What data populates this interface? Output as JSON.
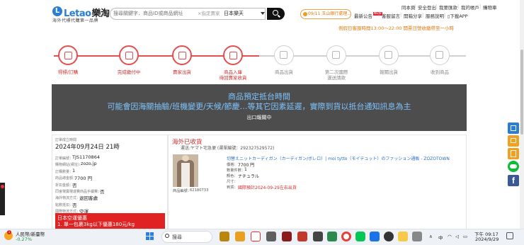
{
  "header": {
    "logo_glyph": "L",
    "logo_text": "Letao",
    "logo_cn": "樂淘",
    "logo_sub": "海外代標代購第一品牌",
    "search_placeholder": "搜尋關鍵字．商品ID或商品網址",
    "search_tag": "×指定賣家",
    "search_select": "日本樂天",
    "notice": "09/11 玉山銀行處理...",
    "links_top": [
      "同本頁",
      "安全登出",
      "我要匯款",
      "我的帳戶",
      "購物車"
    ],
    "links_bottom": [
      "最新公告",
      "客服留言",
      "開箱分享",
      "服務說明",
      "下載APP"
    ],
    "new_badge": "NEW",
    "hours_notice": "例假日客服時間13:00～22:00   開票日營收繳帶至一小時"
  },
  "steps": [
    {
      "label": "得標/訂購",
      "active": true,
      "icon": "hammer-icon"
    },
    {
      "label": "完成繳付中",
      "active": true,
      "icon": "handshake-icon"
    },
    {
      "label": "賣家出貨",
      "active": true,
      "icon": "truck-icon"
    },
    {
      "label": "商品入庫\n待回賣家收貨",
      "active": true,
      "icon": "box-icon"
    },
    {
      "label": "商品出貨",
      "active": false,
      "icon": "ship-icon"
    },
    {
      "label": "第二次國際\n運送請款",
      "active": false,
      "icon": "document-icon"
    },
    {
      "label": "報關出貨",
      "active": false,
      "icon": "clipboard-icon"
    },
    {
      "label": "收到商品",
      "active": false,
      "icon": "hand-heart-icon"
    }
  ],
  "banner": {
    "line1": "商品預定抵台時間",
    "line2": "可能會因海關抽驗/班機變更/天候/節慶…等其它因素延遲，實際到貨以抵台通知訊息為主",
    "status": "出口報關中"
  },
  "order": {
    "date_label": "訂單成立時間",
    "date_value": "2024年09月24日 21時",
    "id_label": "訂單編號：",
    "id_value": "TJS1170864",
    "site_label": "購物網站(網址)：",
    "site_value": "zozo.jp",
    "qty_label": "訂購數量：",
    "qty_value": "1",
    "total_label": "商品總金額：",
    "total_value": "7700 円",
    "coupon_label": "折扣金額：",
    "coupon_value": "否",
    "fee_label": "同會場賣場運費商品手續費：",
    "fee_value": "否",
    "ship_label": "海外物流方式：",
    "ship_value": "退回客處",
    "points_label": "點數抵扣：",
    "points_value": "否",
    "pay_label": "國際物流方式：",
    "pay_value": "空運",
    "promo_title": "日本空運優惠",
    "promo_line": "1. 單一包裹3kg以下優惠180元/kg"
  },
  "shipment": {
    "status": "海外已收貨",
    "header": "運送:ヤマト宅急便 (運單編號：292327529572)",
    "product": "切替えニットカーディガン（カーディガン/ボレロ）| moi tytto（モイテュット）のファッション通販 - ZOZOTOWN",
    "price_label": "價格：",
    "price_value": "7700 円",
    "qty_label": "數量件數：",
    "qty_value": "1",
    "color_label": "顏色：",
    "color_value": "ナチュラル",
    "size_label": "尺寸：",
    "size_value": "",
    "eta_label": "到貨：",
    "eta_value": "國際預計2024-09-29左右出貨",
    "item_id_label": "商品編號：",
    "item_id_value": "62180733"
  },
  "taskbar": {
    "weather_temp": "人民幣/新臺幣",
    "weather_change": "-0.27%",
    "search": "搜尋",
    "lang": "中",
    "time": "下午 09:17",
    "date": "2024/9/29"
  },
  "colors": {
    "accent": "#e45050",
    "brand": "#2a7fd4",
    "banner_text": "#7cc4ff",
    "promo": "#e02222"
  }
}
